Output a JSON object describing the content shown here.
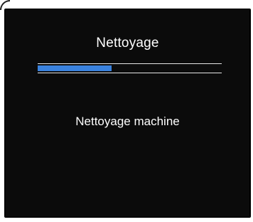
{
  "screen": {
    "title": "Nettoyage",
    "message": "Nettoyage machine",
    "progress": 0.4
  },
  "colors": {
    "background": "#0b0b0b",
    "text": "#ffffff",
    "progress_fill": "#3a82de",
    "progress_track_lines": "#e6e6e6"
  }
}
